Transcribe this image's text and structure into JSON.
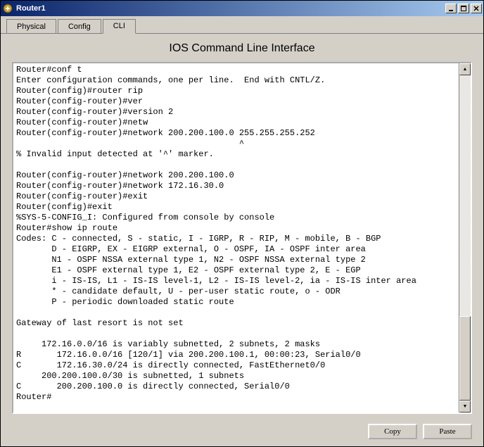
{
  "window": {
    "title": "Router1"
  },
  "tabs": {
    "physical": "Physical",
    "config": "Config",
    "cli": "CLI"
  },
  "panel": {
    "title": "IOS Command Line Interface"
  },
  "terminal": {
    "content": "Router#conf t\nEnter configuration commands, one per line.  End with CNTL/Z.\nRouter(config)#router rip\nRouter(config-router)#ver\nRouter(config-router)#version 2\nRouter(config-router)#netw\nRouter(config-router)#network 200.200.100.0 255.255.255.252\n                                            ^\n% Invalid input detected at '^' marker.\n\nRouter(config-router)#network 200.200.100.0\nRouter(config-router)#network 172.16.30.0\nRouter(config-router)#exit\nRouter(config)#exit\n%SYS-5-CONFIG_I: Configured from console by console\nRouter#show ip route\nCodes: C - connected, S - static, I - IGRP, R - RIP, M - mobile, B - BGP\n       D - EIGRP, EX - EIGRP external, O - OSPF, IA - OSPF inter area\n       N1 - OSPF NSSA external type 1, N2 - OSPF NSSA external type 2\n       E1 - OSPF external type 1, E2 - OSPF external type 2, E - EGP\n       i - IS-IS, L1 - IS-IS level-1, L2 - IS-IS level-2, ia - IS-IS inter area\n       * - candidate default, U - per-user static route, o - ODR\n       P - periodic downloaded static route\n\nGateway of last resort is not set\n\n     172.16.0.0/16 is variably subnetted, 2 subnets, 2 masks\nR       172.16.0.0/16 [120/1] via 200.200.100.1, 00:00:23, Serial0/0\nC       172.16.30.0/24 is directly connected, FastEthernet0/0\n     200.200.100.0/30 is subnetted, 1 subnets\nC       200.200.100.0 is directly connected, Serial0/0\nRouter#"
  },
  "buttons": {
    "copy": "Copy",
    "paste": "Paste"
  }
}
